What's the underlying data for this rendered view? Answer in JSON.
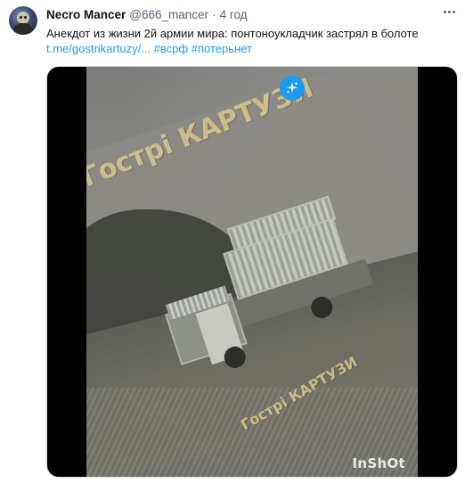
{
  "tweet": {
    "display_name": "Necro Mancer",
    "handle": "@666_mancer",
    "separator": "·",
    "time": "4 год",
    "text": "Анекдот из жизни 2й армии мира: понтоноукладчик застрял в болоте",
    "link": "t.me/gostrikartuzy/...",
    "hashtags": [
      "#всрф",
      "#потерьнет"
    ]
  },
  "media": {
    "watermark_large": "Гострі КАРТУЗИ",
    "watermark_small": "Гострі КАРТУЗИ",
    "app_logo": "InShOt",
    "grok_icon": "sparkle-icon"
  },
  "colors": {
    "link": "#1d9bf0",
    "secondary_text": "#536471",
    "primary_text": "#0f1419"
  }
}
